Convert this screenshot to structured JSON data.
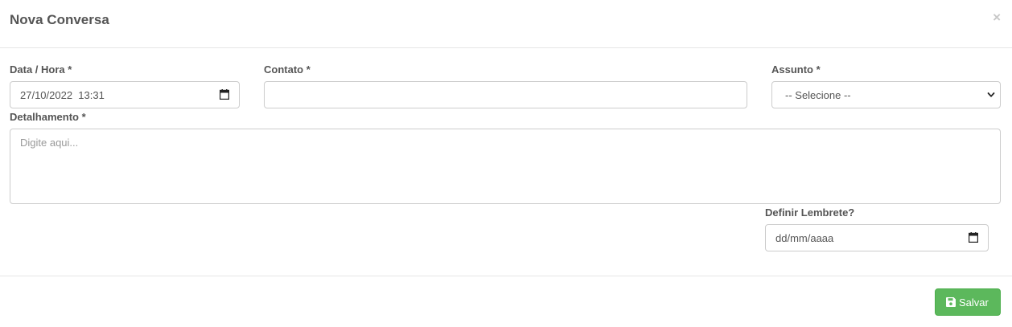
{
  "modal": {
    "title": "Nova Conversa",
    "close_symbol": "×"
  },
  "form": {
    "datetime": {
      "label": "Data / Hora *",
      "value": "27/10/2022  13:31",
      "icon": "calendar-icon"
    },
    "contact": {
      "label": "Contato *",
      "value": ""
    },
    "subject": {
      "label": "Assunto *",
      "selected": "-- Selecione --",
      "icon": "chevron-down-icon"
    },
    "details": {
      "label": "Detalhamento *",
      "placeholder": "Digite aqui..."
    },
    "reminder": {
      "label": "Definir Lembrete?",
      "placeholder": "dd/mm/aaaa",
      "icon": "calendar-icon"
    }
  },
  "footer": {
    "save_label": "Salvar",
    "save_icon": "floppy-disk-icon",
    "save_color": "#5cb85c"
  }
}
